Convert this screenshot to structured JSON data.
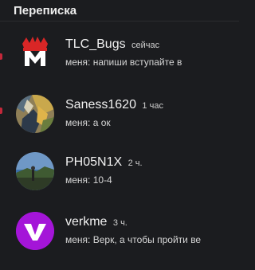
{
  "header": {
    "title": "Переписка"
  },
  "conversations": [
    {
      "name": "TLC_Bugs",
      "time": "сейчас",
      "preview": "меня: напиши вступайте в",
      "unread": true,
      "avatar": "red-m-logo-icon"
    },
    {
      "name": "Saness1620",
      "time": "1 час",
      "preview": "меня: а ок",
      "unread": true,
      "avatar": "user-photo-avatar"
    },
    {
      "name": "PH05N1X",
      "time": "2 ч.",
      "preview": "меня: 10-4",
      "unread": false,
      "avatar": "landscape-photo-avatar"
    },
    {
      "name": "verkme",
      "time": "3 ч.",
      "preview": "меня: Верк, а чтобы пройти ве",
      "unread": false,
      "avatar": "purple-v-logo-icon"
    }
  ],
  "colors": {
    "background": "#1b1c1f",
    "unread_mark": "#c4283a",
    "verkme_avatar": "#a415d8"
  }
}
